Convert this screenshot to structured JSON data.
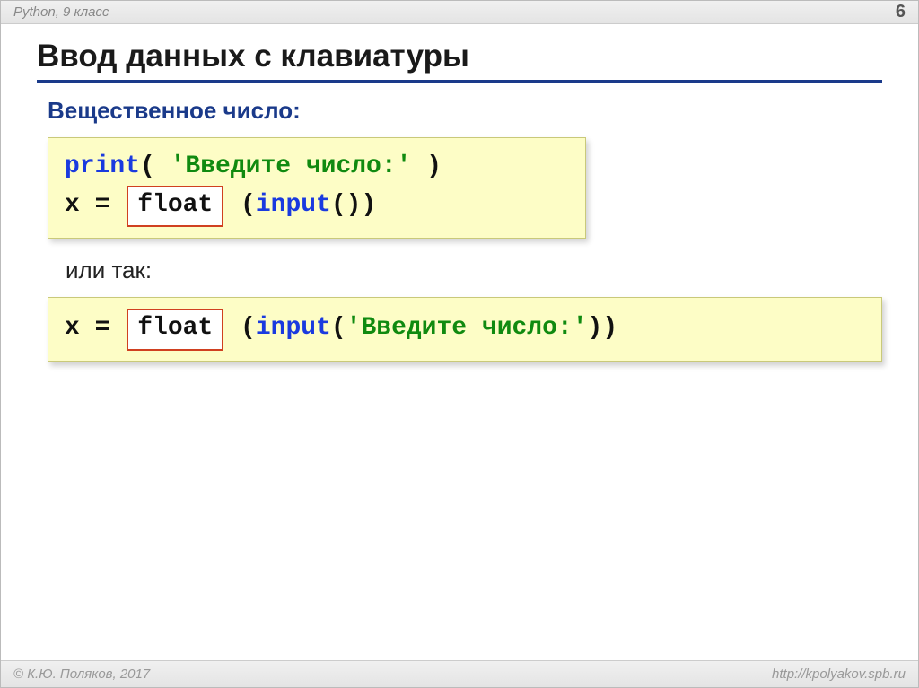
{
  "header": {
    "course": "Python, 9 класс",
    "page_number": "6"
  },
  "title": "Ввод данных с клавиатуры",
  "subheading": "Вещественное число:",
  "code1": {
    "print_kw": "print",
    "print_open": "( ",
    "print_str": "'Введите число:'",
    "print_close": " )",
    "line2_prefix": "x = ",
    "float_box": "float",
    "line2_mid": " (",
    "input_kw": "input",
    "line2_end": "())"
  },
  "between_text": "или так:",
  "code2": {
    "prefix": "x = ",
    "float_box": "float",
    "mid": " (",
    "input_kw": "input",
    "after_input": "(",
    "prompt_str": "'Введите число:'",
    "close": "))"
  },
  "footer": {
    "copyright": "© К.Ю. Поляков, 2017",
    "url": "http://kpolyakov.spb.ru"
  }
}
